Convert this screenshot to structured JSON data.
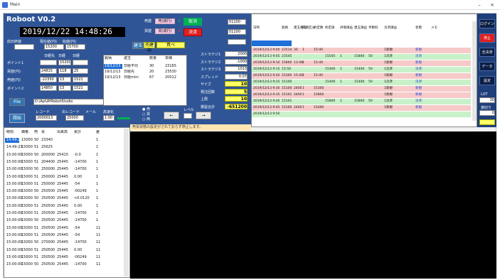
{
  "window": {
    "title": "Main",
    "minimize": "–",
    "close": "×"
  },
  "app": {
    "name": "Roboot V0.2",
    "clock": "2019/12/22 14:48:26"
  },
  "account": {
    "label_a": "前日終値",
    "label_b": "現在値(円)",
    "label_c": "始値(円)",
    "val_a": "",
    "val_b": "15200",
    "val_c": "15700",
    "labels2": [
      "日経先",
      "日経",
      "日経"
    ],
    "rows": [
      {
        "label": "ポイント1",
        "v1": "",
        "v2": "15200",
        "v3": ""
      },
      {
        "label": "買値(円)",
        "v1": "24815",
        "v2": "118",
        "v3": "25"
      },
      {
        "label": "売値(円)",
        "v1": "-22350",
        "v2": "13",
        "v3": "1521"
      },
      {
        "label": "ポイント2",
        "v1": "14850",
        "v2": "13",
        "v3": "1521"
      }
    ]
  },
  "file": {
    "button": "File",
    "path": "D:\\Api\\AYRobotStudio"
  },
  "controls": {
    "start": "開始",
    "label1": "レコード",
    "label2": "出レコード",
    "label3": "メール",
    "label4": "高速化",
    "start_value": "2000013",
    "val2": "25000",
    "val3": "1:00"
  },
  "middle": {
    "order_label1": "売建",
    "order_label2": "買建",
    "sell": "売(成行)",
    "buy": "買(成行)",
    "cancel": "取消",
    "settle": "決済",
    "spin1": "51100",
    "spin2": "51100",
    "tab": "建玉",
    "inbox": "売建中",
    "inbox2": "買ベ",
    "grid_headers": [
      "銘柄",
      "建玉",
      "数量",
      "単価"
    ],
    "grid_rows": [
      [
        "19/12/13",
        "日経平均",
        "30",
        "23165"
      ],
      [
        "19/12/13",
        "日経先",
        "20",
        "23530"
      ],
      [
        "19/12/13",
        "日経mini",
        "67",
        "20012"
      ]
    ],
    "metrics": [
      {
        "label": "ストラテジ1",
        "value": "2000"
      },
      {
        "label": "ストラテジ2",
        "value": "-1000"
      },
      {
        "label": "ストラテジ3",
        "value": "1013"
      },
      {
        "label": "スプレッド",
        "value": "0.07"
      },
      {
        "label": "サイズ",
        "value": "10"
      },
      {
        "label": "発注回数",
        "value": "5"
      },
      {
        "label": "上限",
        "value": "10"
      },
      {
        "label": "損益合計",
        "value": "-651200"
      }
    ],
    "radios": [
      "売",
      "買",
      "両"
    ],
    "arrow_left": "←",
    "arrow_right": "→",
    "level_label": "レベル"
  },
  "status": {
    "message": "売買状態の設定がされておらず停止します。"
  },
  "log": {
    "headers": [
      "日時",
      "銘柄",
      "建玉番号",
      "売買区分",
      "約定数",
      "約定値",
      "評価損益",
      "建玉損益",
      "手数料",
      "決済損益",
      "状態",
      "メモ"
    ],
    "rows": [
      {
        "time": "2019/12/13 9:00",
        "v": [
          "23514",
          "30",
          "1",
          "15:40",
          "",
          "",
          "",
          "",
          "1新規",
          "新規"
        ],
        "color": "#f7caca"
      },
      {
        "time": "2019/12/13 9:05",
        "v": [
          "23545",
          "",
          "",
          "",
          "15505",
          "1",
          "15800",
          "50",
          "1決済",
          "決済"
        ],
        "color": "#c9f1c9"
      },
      {
        "time": "2019/12/13 9:10",
        "v": [
          "15800",
          "13:48",
          "1",
          "15:40",
          "",
          "",
          "",
          "",
          "1新規",
          "新規"
        ],
        "color": "#f7caca"
      },
      {
        "time": "2019/12/13 9:15",
        "v": [
          "15:50",
          "",
          "",
          "",
          "15400",
          "1",
          "15400",
          "50",
          "1決済",
          "決済"
        ],
        "color": "#c9f1c9"
      },
      {
        "time": "2019/12/13 9:20",
        "v": [
          "15300",
          "15:40",
          "1",
          "15:40",
          "",
          "",
          "",
          "",
          "1新規",
          "新規"
        ],
        "color": "#f7caca"
      },
      {
        "time": "2019/12/13 9:25",
        "v": [
          "15100",
          "",
          "",
          "",
          "15400",
          "1",
          "15400",
          "50",
          "1決済",
          "決済"
        ],
        "color": "#c9f1c9"
      },
      {
        "time": "2019/12/13 9:30",
        "v": [
          "15100",
          "2400",
          "1",
          "15300",
          "",
          "",
          "",
          "",
          "1新規",
          "新規"
        ],
        "color": "#f7caca"
      },
      {
        "time": "2019/12/13 9:35",
        "v": [
          "15101",
          "2400",
          "1",
          "15800",
          "",
          "",
          "",
          "",
          "1新規",
          "新規"
        ],
        "color": "#f7caca"
      },
      {
        "time": "2019/12/13 9:40",
        "v": [
          "15101",
          "",
          "",
          "",
          "15800",
          "1",
          "15800",
          "50",
          "1決済",
          "決済"
        ],
        "color": "#c9f1c9"
      },
      {
        "time": "2019/12/13 9:45",
        "v": [
          "15100",
          "2400",
          "1",
          "15400",
          "",
          "",
          "",
          "",
          "1新規",
          "新規"
        ],
        "color": "#f7caca"
      },
      {
        "time": "2019/12/13 9:50",
        "v": [
          "",
          "",
          "",
          "",
          "",
          "",
          "",
          "",
          "",
          ""
        ],
        "color": "#c9f1c9"
      }
    ]
  },
  "side": {
    "buttons": [
      "ログイン",
      "停止",
      "全決済",
      "データ",
      "設定"
    ],
    "label": "LOT",
    "val1": "30",
    "label2": "損切り",
    "val2": "0"
  },
  "table": {
    "headers": [
      "時刻",
      "価格",
      "売",
      "買",
      "出来高",
      "累計",
      "差"
    ],
    "rows": [
      [
        "14:49:23",
        "15000",
        "50",
        "23340",
        "",
        "",
        "1"
      ],
      [
        "14:49:23",
        "15000",
        "51",
        "25625",
        "",
        "",
        "1"
      ],
      [
        "15:00:00",
        "15000",
        "50",
        "200000",
        "25415",
        "-0.0",
        "1"
      ],
      [
        "15:00:00",
        "15000",
        "51",
        "204400",
        "25445",
        "-14700",
        "1"
      ],
      [
        "15:00:00",
        "15000",
        "50",
        "250000",
        "25445",
        "-14700",
        "1"
      ],
      [
        "15:00:00",
        "15000",
        "51",
        "250000",
        "25445",
        "0.00",
        "1"
      ],
      [
        "15:00:00",
        "15000",
        "51",
        "250000",
        "25445",
        "-54",
        "1"
      ],
      [
        "15:00:00",
        "15000",
        "50",
        "250500",
        "25445",
        "-00249",
        "1"
      ],
      [
        "15:00:00",
        "15000",
        "50",
        "250500",
        "25445",
        "+0.0120",
        "1"
      ],
      [
        "15:00:00",
        "15000",
        "51",
        "250500",
        "25445",
        "0.00",
        "1"
      ],
      [
        "15:00:00",
        "15000",
        "51",
        "250500",
        "25445",
        "-14700",
        "1"
      ],
      [
        "15:00:00",
        "15000",
        "50",
        "250500",
        "25445",
        "-14700",
        "1"
      ],
      [
        "15:00:00",
        "15000",
        "51",
        "250500",
        "25445",
        "-54",
        "11"
      ],
      [
        "15:00:00",
        "15000",
        "51",
        "250500",
        "25445",
        "-54",
        "11"
      ],
      [
        "15:00:00",
        "15000",
        "50",
        "270000",
        "25445",
        "-14700",
        "11"
      ],
      [
        "15:00:00",
        "15000",
        "51",
        "250500",
        "25445",
        "0.00",
        "11"
      ],
      [
        "15:00:00",
        "15000",
        "51",
        "250500",
        "25445",
        "-00249",
        "11"
      ],
      [
        "15:00:00",
        "15000",
        "50",
        "250500",
        "25445",
        "-14700",
        "11"
      ]
    ]
  }
}
